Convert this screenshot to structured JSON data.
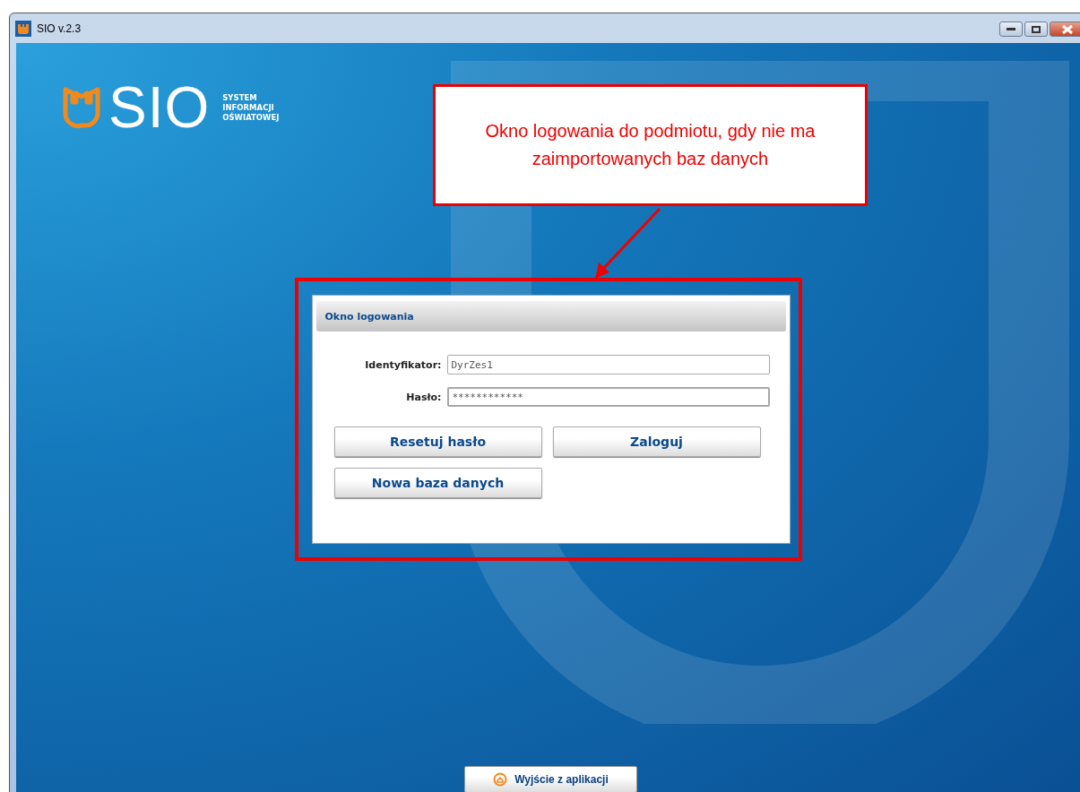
{
  "window": {
    "title": "SIO v.2.3"
  },
  "logo": {
    "wordmark": "SIO",
    "tagline": [
      "SYSTEM",
      "INFORMACJI",
      "OŚWIATOWEJ"
    ]
  },
  "callout": {
    "text": "Okno logowania do podmiotu, gdy nie ma zaimportowanych baz danych"
  },
  "login_dialog": {
    "title": "Okno logowania",
    "fields": [
      {
        "label": "Identyfikator:",
        "value": "DyrZes1",
        "focused": false
      },
      {
        "label": "Hasło:",
        "value": "************",
        "focused": true
      }
    ],
    "buttons": [
      "Resetuj hasło",
      "Zaloguj",
      "Nowa baza danych"
    ]
  },
  "exit_button": {
    "label": "Wyjście z aplikacji"
  }
}
